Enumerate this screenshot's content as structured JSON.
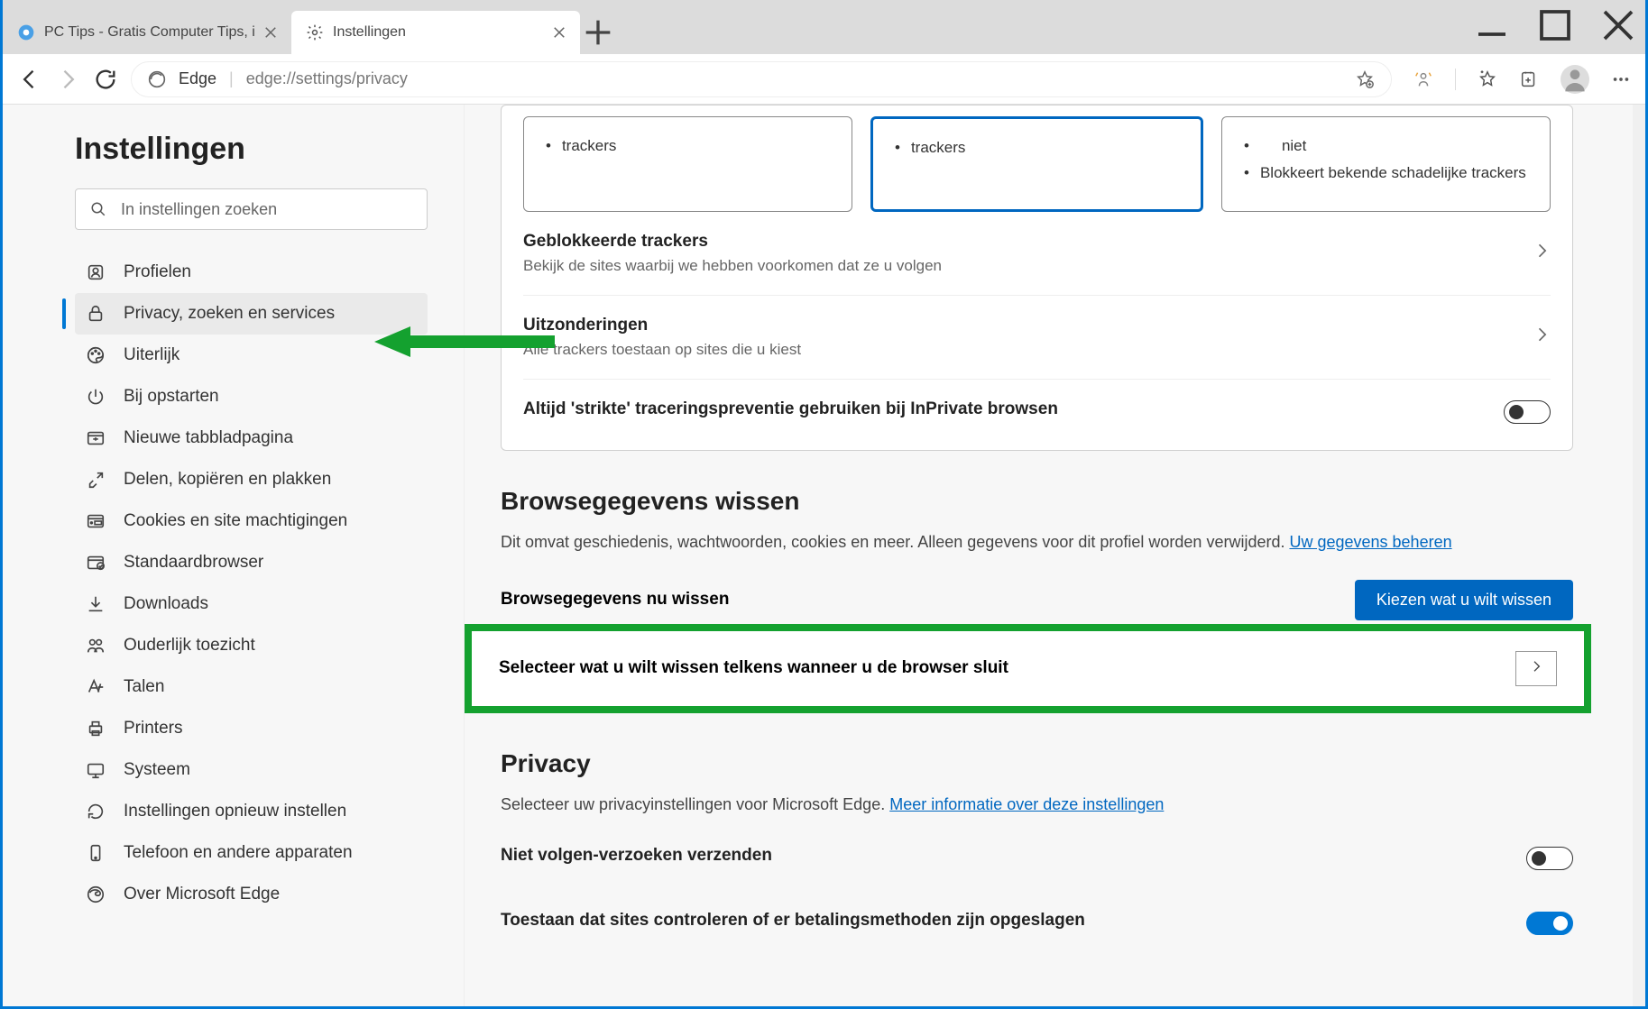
{
  "window": {
    "title": "Instellingen"
  },
  "tabs": [
    {
      "title": "PC Tips - Gratis Computer Tips, i",
      "active": false
    },
    {
      "title": "Instellingen",
      "active": true
    }
  ],
  "addressbar": {
    "scheme_label": "Edge",
    "url": "edge://settings/privacy"
  },
  "sidebar": {
    "title": "Instellingen",
    "search_placeholder": "In instellingen zoeken",
    "items": [
      {
        "label": "Profielen",
        "icon": "profile-icon"
      },
      {
        "label": "Privacy, zoeken en services",
        "icon": "lock-icon",
        "active": true
      },
      {
        "label": "Uiterlijk",
        "icon": "appearance-icon"
      },
      {
        "label": "Bij opstarten",
        "icon": "power-icon"
      },
      {
        "label": "Nieuwe tabbladpagina",
        "icon": "newtab-icon"
      },
      {
        "label": "Delen, kopiëren en plakken",
        "icon": "share-icon"
      },
      {
        "label": "Cookies en site machtigingen",
        "icon": "cookies-icon"
      },
      {
        "label": "Standaardbrowser",
        "icon": "default-browser-icon"
      },
      {
        "label": "Downloads",
        "icon": "download-icon"
      },
      {
        "label": "Ouderlijk toezicht",
        "icon": "family-icon"
      },
      {
        "label": "Talen",
        "icon": "languages-icon"
      },
      {
        "label": "Printers",
        "icon": "printers-icon"
      },
      {
        "label": "Systeem",
        "icon": "system-icon"
      },
      {
        "label": "Instellingen opnieuw instellen",
        "icon": "reset-icon"
      },
      {
        "label": "Telefoon en andere apparaten",
        "icon": "phone-icon"
      },
      {
        "label": "Over Microsoft Edge",
        "icon": "edge-icon"
      }
    ]
  },
  "tracking_cards": {
    "basic": "trackers",
    "balanced": "trackers",
    "strict_line1": "niet",
    "strict_line2": "Blokkeert bekende schadelijke trackers"
  },
  "tracking_rows": {
    "blocked_title": "Geblokkeerde trackers",
    "blocked_desc": "Bekijk de sites waarbij we hebben voorkomen dat ze u volgen",
    "except_title": "Uitzonderingen",
    "except_desc": "Alle trackers toestaan op sites die u kiest",
    "strict_inprivate": "Altijd 'strikte' traceringspreventie gebruiken bij InPrivate browsen"
  },
  "clear_section": {
    "heading": "Browsegegevens wissen",
    "desc": "Dit omvat geschiedenis, wachtwoorden, cookies en meer. Alleen gegevens voor dit profiel worden verwijderd. ",
    "link": "Uw gegevens beheren",
    "now_label": "Browsegegevens nu wissen",
    "now_button": "Kiezen wat u wilt wissen",
    "onclose_label": "Selecteer wat u wilt wissen telkens wanneer u de browser sluit"
  },
  "privacy_section": {
    "heading": "Privacy",
    "desc": "Selecteer uw privacyinstellingen voor Microsoft Edge. ",
    "link": "Meer informatie over deze instellingen",
    "dnt": "Niet volgen-verzoeken verzenden",
    "payment": "Toestaan dat sites controleren of er betalingsmethoden zijn opgeslagen"
  }
}
